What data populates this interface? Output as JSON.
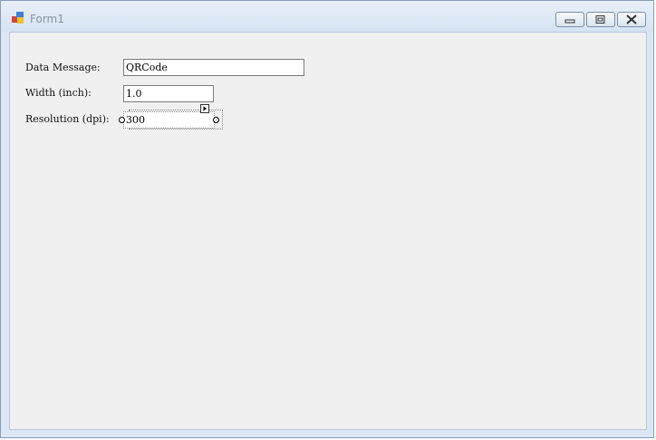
{
  "window": {
    "title": "Form1",
    "icon": "form-app-icon",
    "controls": {
      "minimize": "minimize-icon",
      "maximize": "maximize-icon",
      "close": "close-icon"
    }
  },
  "form": {
    "fields": [
      {
        "label": "Data Message:",
        "value": "QRCode"
      },
      {
        "label": "Width (inch):",
        "value": "1.0"
      },
      {
        "label": "Resolution (dpi):",
        "value": "300"
      }
    ]
  }
}
